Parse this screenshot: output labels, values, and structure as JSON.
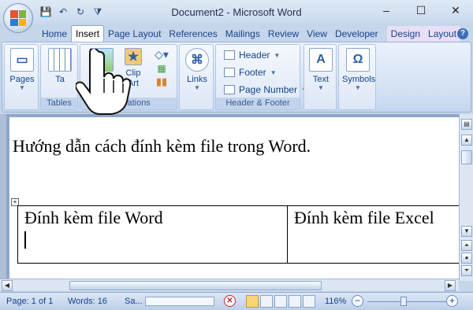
{
  "window": {
    "title": "Document2 - Microsoft Word",
    "minimize": "–",
    "maximize": "☐",
    "close": "✕"
  },
  "qat": {
    "save": "💾",
    "undo": "↶",
    "redo": "↻",
    "customize": "⧩"
  },
  "tabs": [
    "Home",
    "Insert",
    "Page Layout",
    "References",
    "Mailings",
    "Review",
    "View",
    "Developer",
    "Design",
    "Layout"
  ],
  "help": "?",
  "ribbon": {
    "pages": {
      "label": "Pages"
    },
    "tables": {
      "table_label": "Ta",
      "group_label": "Tables"
    },
    "illustrations": {
      "clipart_label": "Clip Art",
      "group_label": "Illustrations"
    },
    "links": {
      "label": "Links"
    },
    "header_footer": {
      "header": "Header",
      "footer": "Footer",
      "page_number": "Page Number",
      "group_label": "Header & Footer"
    },
    "text": {
      "label": "Text"
    },
    "symbols": {
      "label": "Symbols"
    }
  },
  "document": {
    "heading": "Hướng dẫn cách đính kèm file trong Word.",
    "table": [
      [
        "Đính kèm file Word",
        "Đính kèm file Excel"
      ]
    ]
  },
  "status": {
    "page": "Page: 1 of 1",
    "words": "Words: 16",
    "saving": "Sa...",
    "zoom": "116%"
  },
  "colors": {
    "accent": "#15428b",
    "ribbon": "#dce7f6",
    "doc_bg": "#8ea6c8"
  }
}
